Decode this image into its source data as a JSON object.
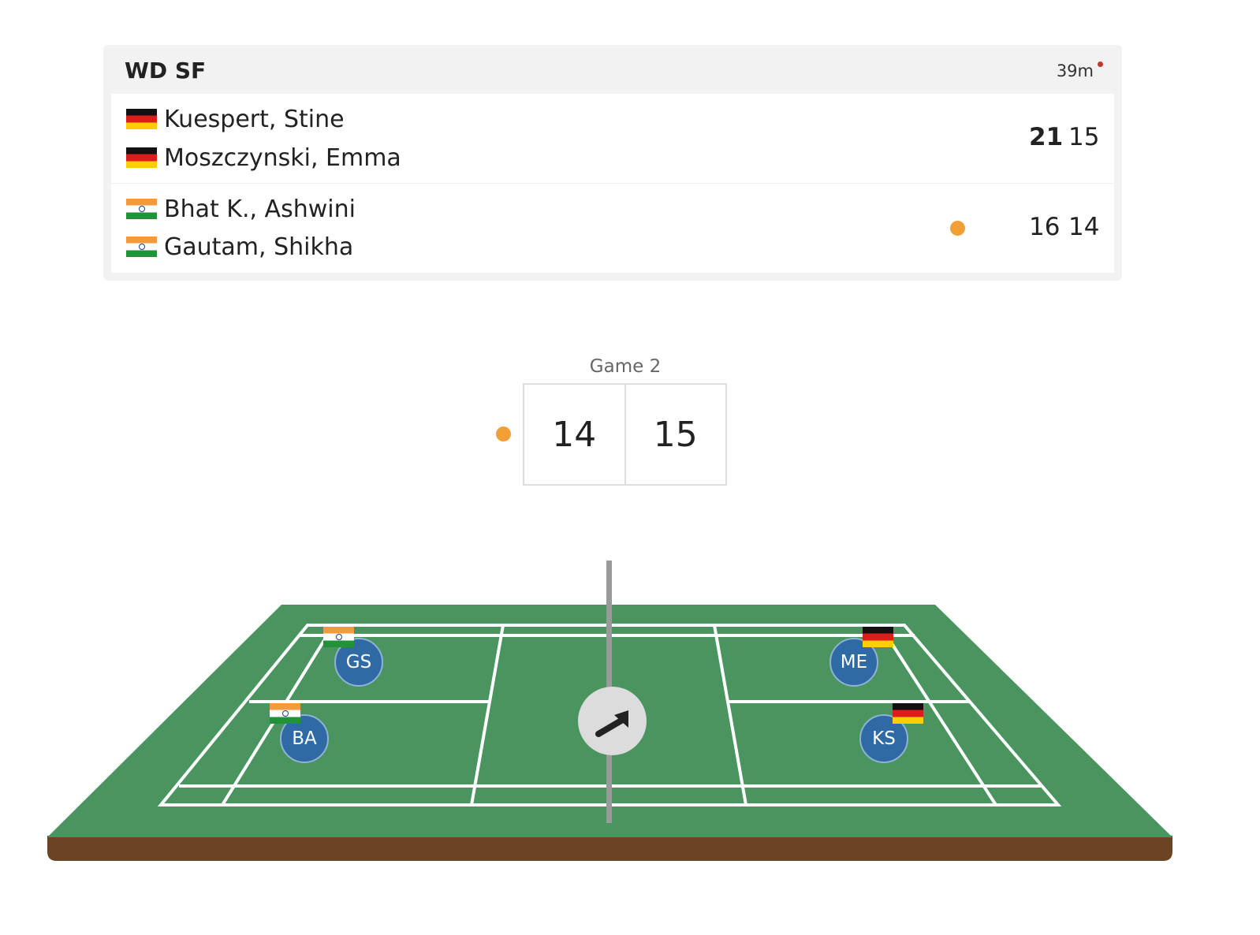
{
  "match": {
    "event": "WD SF",
    "duration": "39m",
    "teams": [
      {
        "players": [
          {
            "name": "Kuespert, Stine",
            "flag": "germany-flag-icon"
          },
          {
            "name": "Moszczynski, Emma",
            "flag": "germany-flag-icon"
          }
        ],
        "scores": [
          "21",
          "15"
        ],
        "serving": false
      },
      {
        "players": [
          {
            "name": "Bhat K., Ashwini",
            "flag": "india-flag-icon"
          },
          {
            "name": "Gautam, Shikha",
            "flag": "india-flag-icon"
          }
        ],
        "scores": [
          "16",
          "14"
        ],
        "serving": true
      }
    ]
  },
  "game": {
    "label": "Game 2",
    "left_score": "14",
    "right_score": "15"
  },
  "court": {
    "players": [
      {
        "initials": "GS",
        "flag": "india-flag-icon"
      },
      {
        "initials": "BA",
        "flag": "india-flag-icon"
      },
      {
        "initials": "ME",
        "flag": "germany-flag-icon"
      },
      {
        "initials": "KS",
        "flag": "germany-flag-icon"
      }
    ],
    "shuttle_direction_icon": "arrow-up-right-icon"
  },
  "colors": {
    "serve_indicator": "#f29f36",
    "court_green": "#4a9460",
    "court_base": "#6b4423",
    "player_marker": "#2f6aa4",
    "live_dot": "#c0392b"
  }
}
